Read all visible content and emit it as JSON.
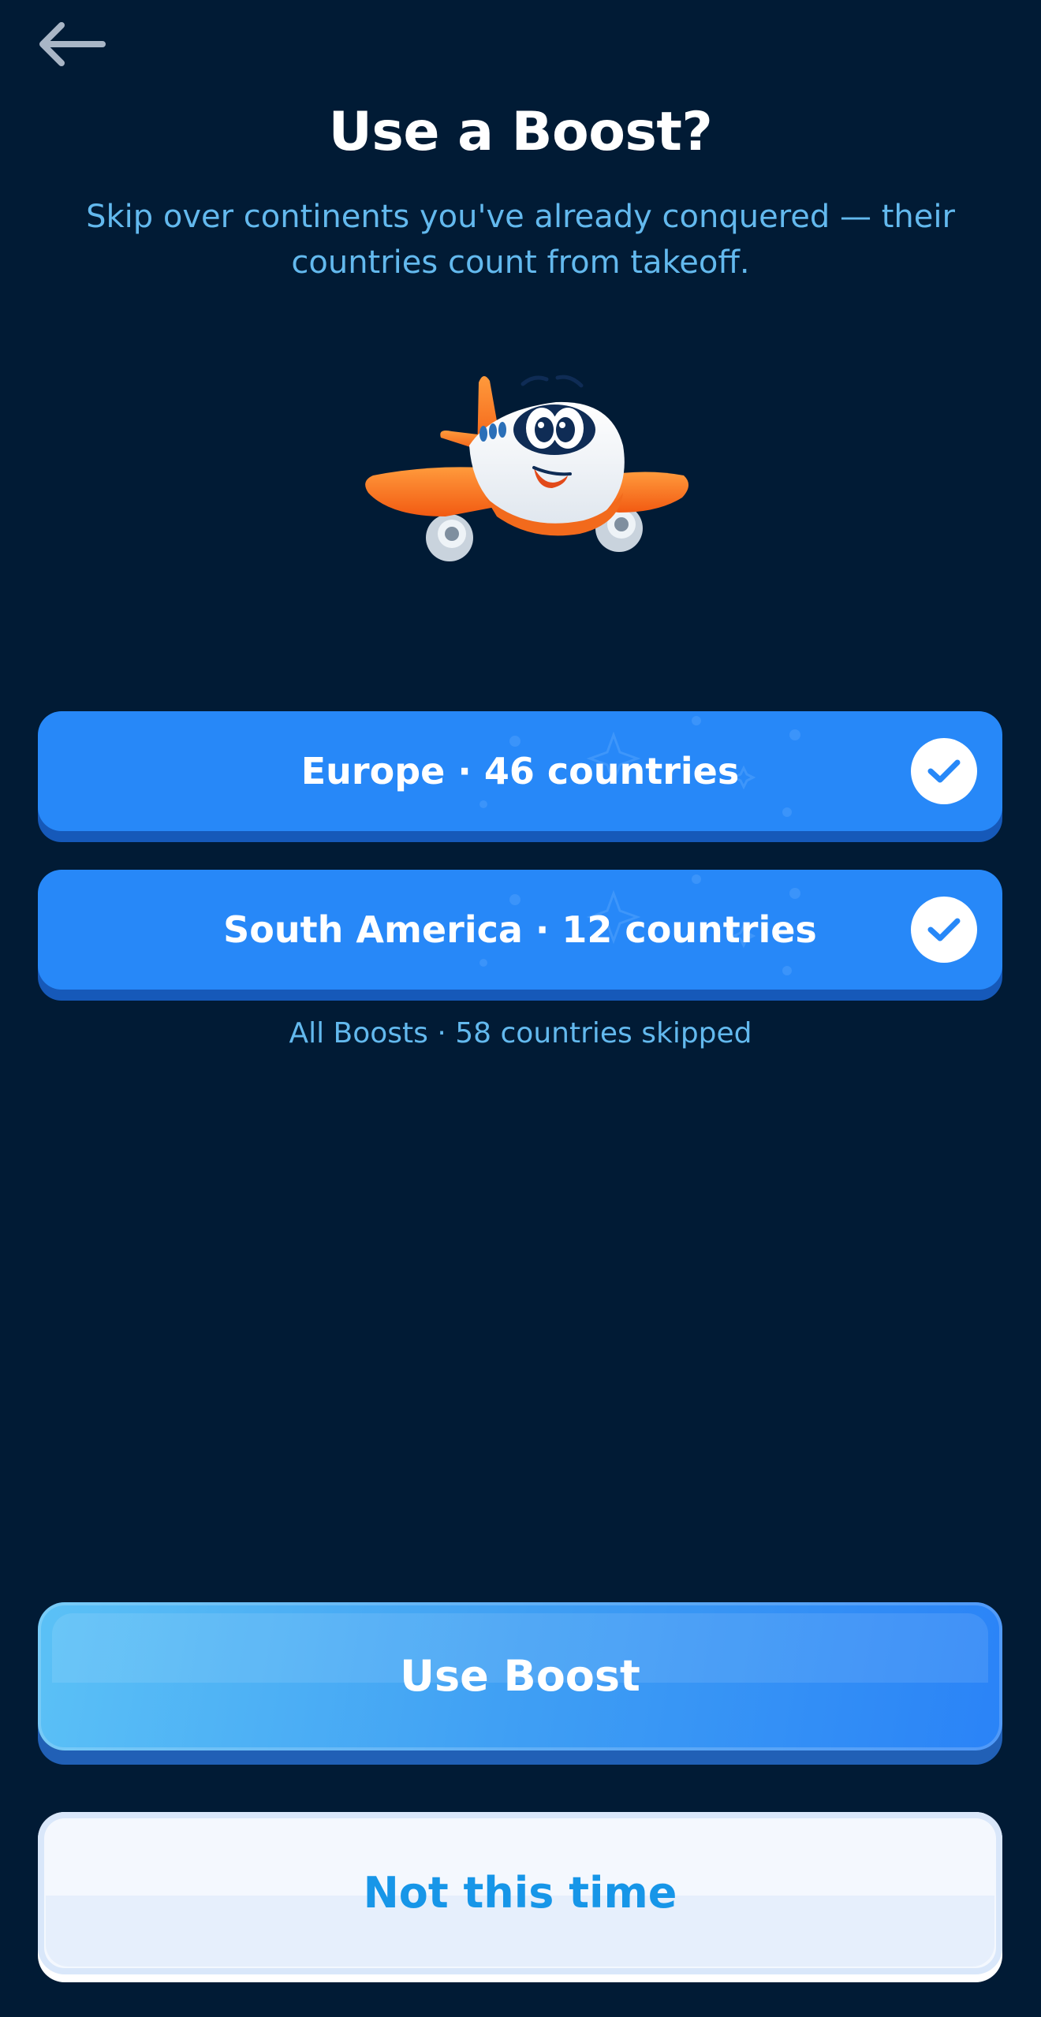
{
  "header": {
    "back_icon": "arrow-left-icon",
    "title": "Use a Boost?",
    "subtitle": "Skip over continents you've already conquered — their countries count from takeoff."
  },
  "mascot": {
    "icon": "airplane-mascot-icon"
  },
  "options": [
    {
      "label": "Europe · 46 countries",
      "checked": true,
      "check_icon": "checkmark-icon"
    },
    {
      "label": "South America · 12 countries",
      "checked": true,
      "check_icon": "checkmark-icon"
    }
  ],
  "summary": "All Boosts · 58 countries skipped",
  "actions": {
    "primary_label": "Use Boost",
    "secondary_label": "Not this time"
  },
  "colors": {
    "background": "#011b35",
    "option_blue": "#2788f8",
    "accent_text": "#63b9ee",
    "secondary_text": "#1796e8"
  }
}
